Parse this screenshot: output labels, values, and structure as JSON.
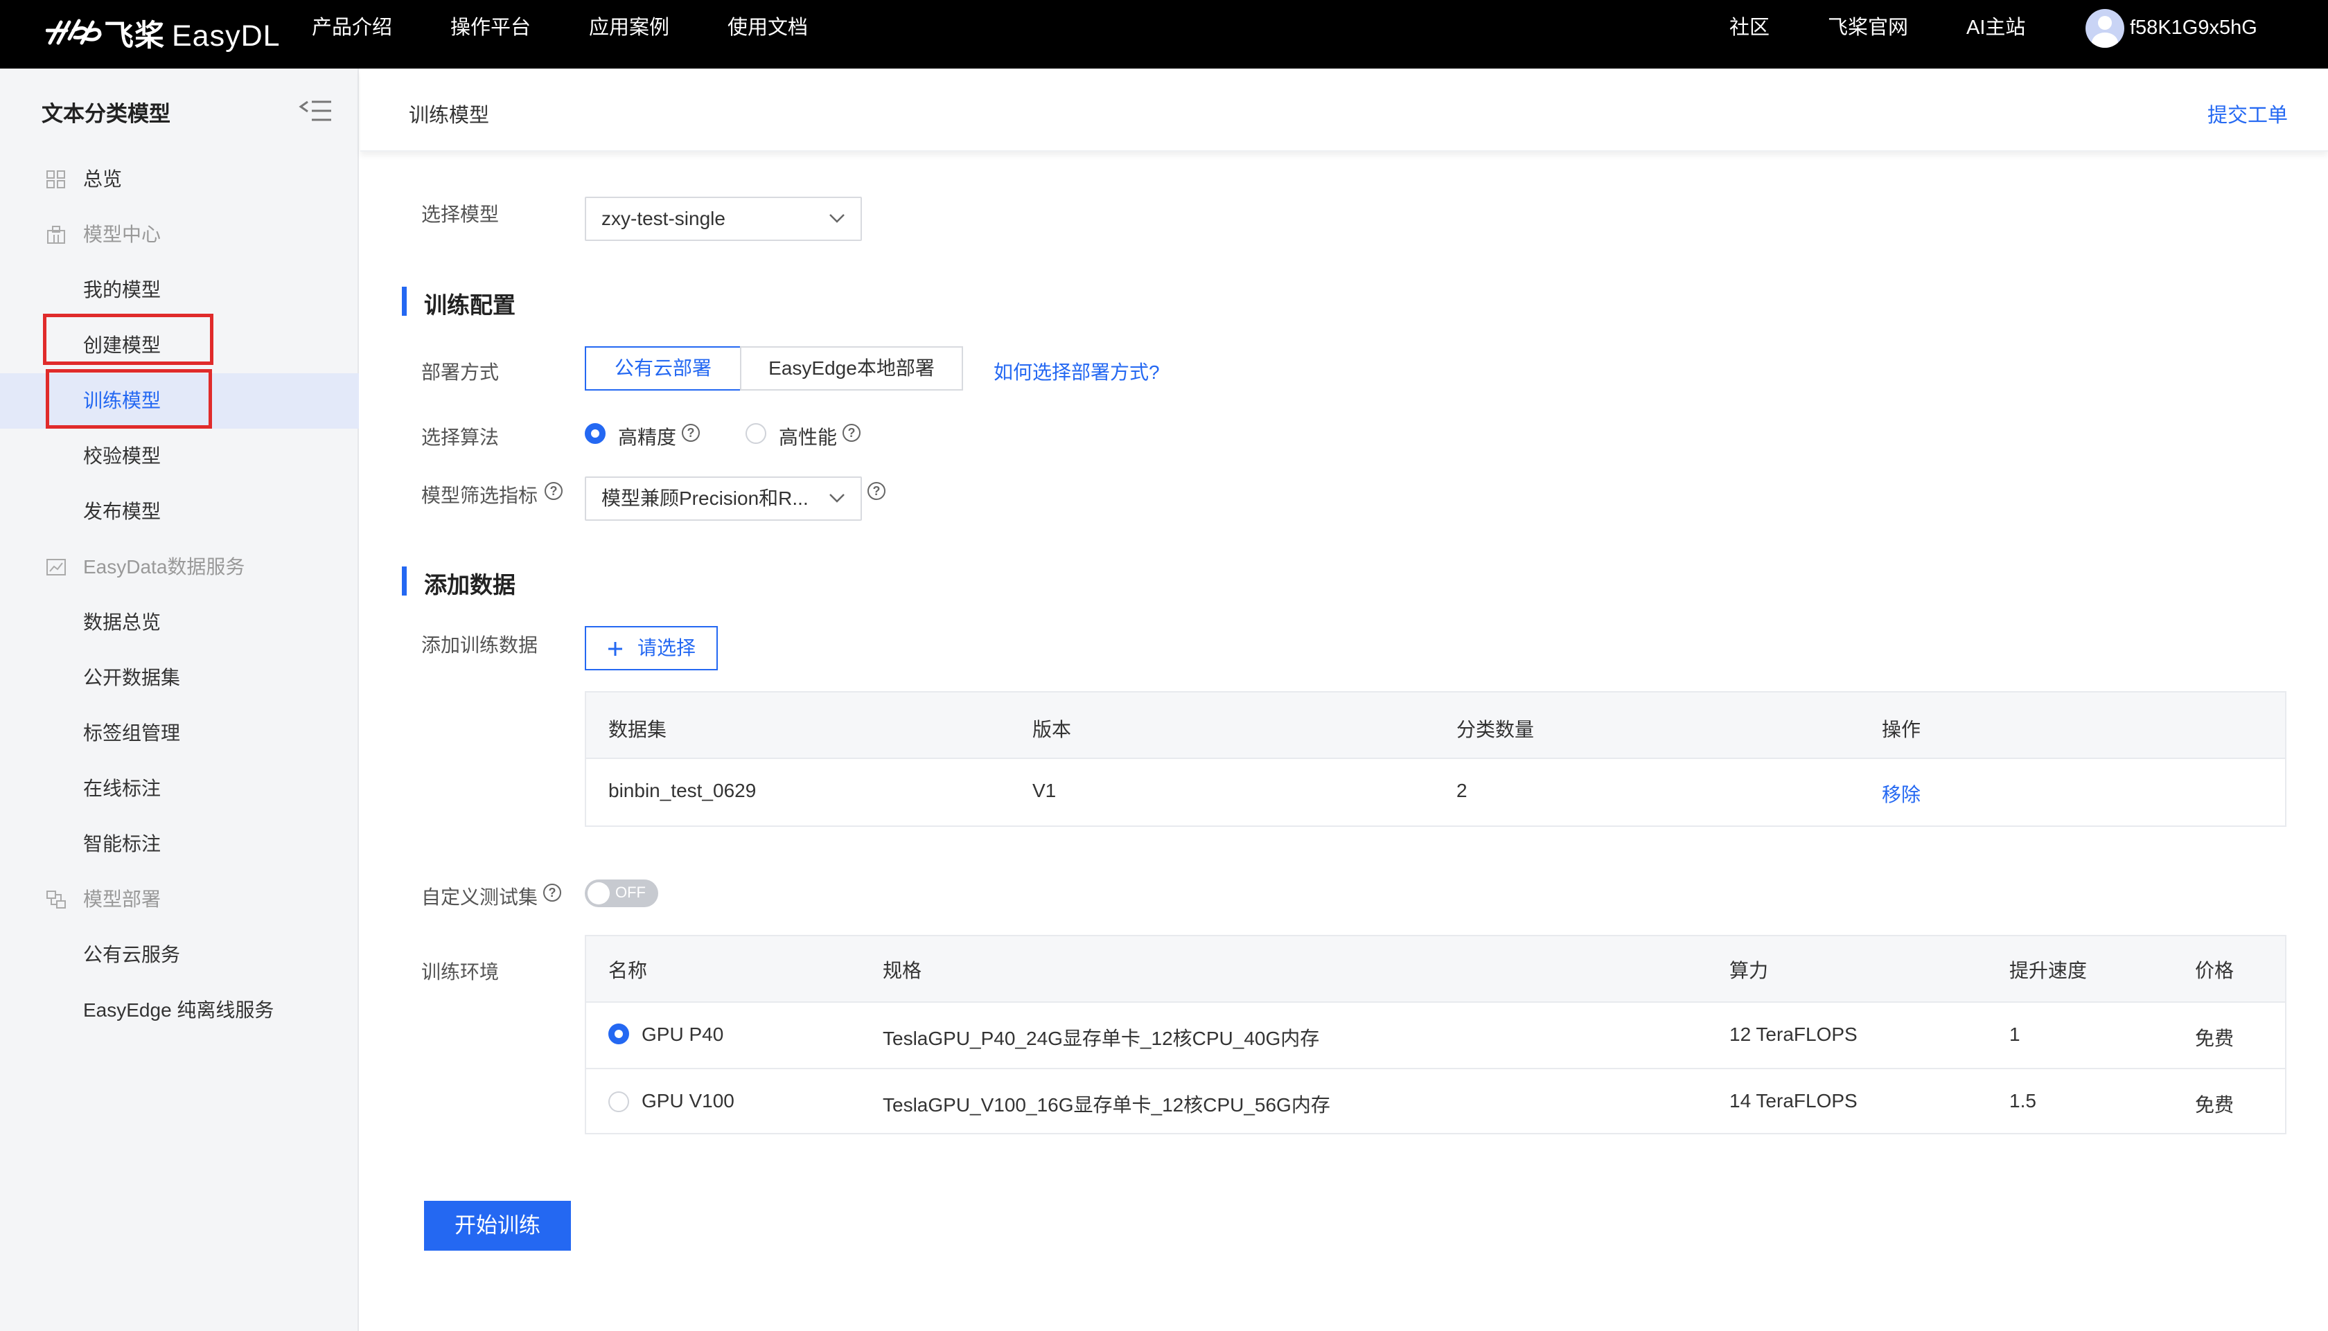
{
  "topbar": {
    "logo_cn": "飞桨",
    "logo_en": "EasyDL",
    "nav": [
      "产品介绍",
      "操作平台",
      "应用案例",
      "使用文档"
    ],
    "right_nav": [
      "社区",
      "飞桨官网",
      "AI主站"
    ],
    "username": "f58K1G9x5hG"
  },
  "sidebar": {
    "title": "文本分类模型",
    "overview": "总览",
    "model_center": "模型中心",
    "my_models": "我的模型",
    "create_model": "创建模型",
    "train_model": "训练模型",
    "validate_model": "校验模型",
    "publish_model": "发布模型",
    "easydata": "EasyData数据服务",
    "data_overview": "数据总览",
    "public_datasets": "公开数据集",
    "tag_groups": "标签组管理",
    "online_labeling": "在线标注",
    "smart_labeling": "智能标注",
    "deploy": "模型部署",
    "public_cloud": "公有云服务",
    "easyedge": "EasyEdge 纯离线服务"
  },
  "header": {
    "breadcrumb": "训练模型",
    "ticket": "提交工单"
  },
  "form": {
    "select_model_label": "选择模型",
    "select_model_value": "zxy-test-single",
    "section_config": "训练配置",
    "deploy_label": "部署方式",
    "deploy_options": [
      "公有云部署",
      "EasyEdge本地部署"
    ],
    "deploy_help": "如何选择部署方式?",
    "algo_label": "选择算法",
    "algo_options": [
      "高精度",
      "高性能"
    ],
    "metric_label": "模型筛选指标",
    "metric_value": "模型兼顾Precision和R...",
    "section_data": "添加数据",
    "add_data_label": "添加训练数据",
    "add_button": "请选择",
    "custom_test_label": "自定义测试集",
    "toggle_state": "OFF",
    "env_label": "训练环境",
    "start_button": "开始训练"
  },
  "dataset_table": {
    "headers": [
      "数据集",
      "版本",
      "分类数量",
      "操作"
    ],
    "rows": [
      {
        "name": "binbin_test_0629",
        "version": "V1",
        "count": "2",
        "action": "移除"
      }
    ]
  },
  "env_table": {
    "headers": [
      "名称",
      "规格",
      "算力",
      "提升速度",
      "价格"
    ],
    "rows": [
      {
        "name": "GPU P40",
        "spec": "TeslaGPU_P40_24G显存单卡_12核CPU_40G内存",
        "power": "12 TeraFLOPS",
        "speed": "1",
        "price": "免费"
      },
      {
        "name": "GPU V100",
        "spec": "TeslaGPU_V100_16G显存单卡_12核CPU_56G内存",
        "power": "14 TeraFLOPS",
        "speed": "1.5",
        "price": "免费"
      }
    ]
  },
  "colors": {
    "accent": "#2468f2",
    "highlight_box": "#e02b2b",
    "topbar": "#000000"
  }
}
